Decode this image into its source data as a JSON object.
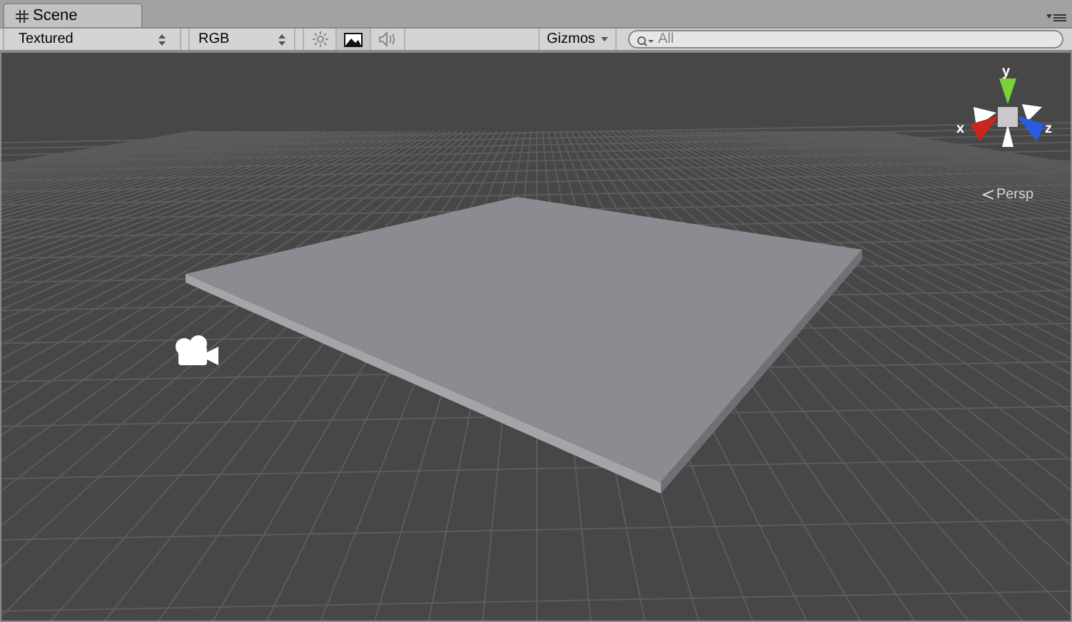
{
  "tab": {
    "title": "Scene"
  },
  "toolbar": {
    "draw_mode": "Textured",
    "render_mode": "RGB",
    "toggles": [
      {
        "kind": "lighting",
        "on": false
      },
      {
        "kind": "image",
        "on": true
      },
      {
        "kind": "audio",
        "on": false
      }
    ],
    "gizmos": "Gizmos",
    "search": {
      "placeholder": "All"
    }
  },
  "orientation_gizmo": {
    "axes": [
      {
        "kind": "y",
        "label": "y"
      },
      {
        "kind": "x",
        "label": "x"
      },
      {
        "kind": "z",
        "label": "z"
      }
    ],
    "projection": "Persp"
  }
}
